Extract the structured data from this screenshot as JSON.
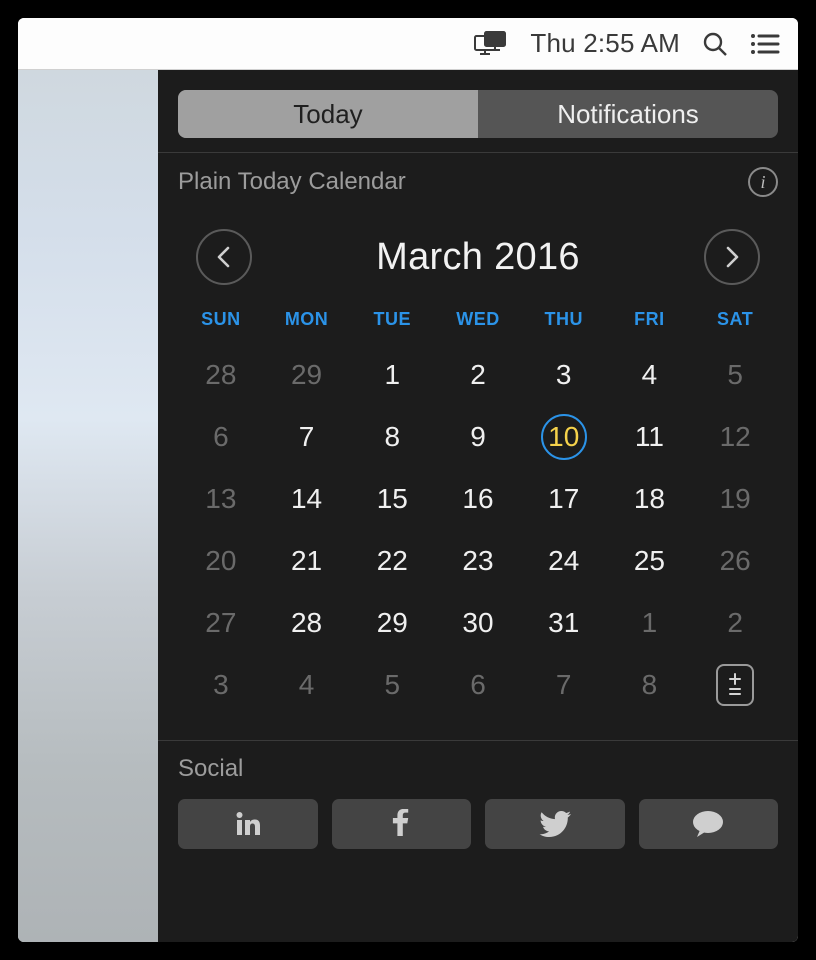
{
  "menubar": {
    "clock": "Thu 2:55 AM"
  },
  "tabs": {
    "today": "Today",
    "notifications": "Notifications",
    "active": "today"
  },
  "widget": {
    "title": "Plain Today Calendar"
  },
  "calendar": {
    "month_label": "March 2016",
    "dow": [
      "SUN",
      "MON",
      "TUE",
      "WED",
      "THU",
      "FRI",
      "SAT"
    ],
    "today": 10,
    "weeks": [
      [
        {
          "n": 28,
          "out": true
        },
        {
          "n": 29,
          "out": true
        },
        {
          "n": 1
        },
        {
          "n": 2
        },
        {
          "n": 3
        },
        {
          "n": 4
        },
        {
          "n": 5,
          "out": true
        }
      ],
      [
        {
          "n": 6,
          "out": true
        },
        {
          "n": 7
        },
        {
          "n": 8
        },
        {
          "n": 9
        },
        {
          "n": 10,
          "today": true
        },
        {
          "n": 11
        },
        {
          "n": 12,
          "out": true
        }
      ],
      [
        {
          "n": 13,
          "out": true
        },
        {
          "n": 14
        },
        {
          "n": 15
        },
        {
          "n": 16
        },
        {
          "n": 17
        },
        {
          "n": 18
        },
        {
          "n": 19,
          "out": true
        }
      ],
      [
        {
          "n": 20,
          "out": true
        },
        {
          "n": 21
        },
        {
          "n": 22
        },
        {
          "n": 23
        },
        {
          "n": 24
        },
        {
          "n": 25
        },
        {
          "n": 26,
          "out": true
        }
      ],
      [
        {
          "n": 27,
          "out": true
        },
        {
          "n": 28
        },
        {
          "n": 29
        },
        {
          "n": 30
        },
        {
          "n": 31
        },
        {
          "n": 1,
          "out": true
        },
        {
          "n": 2,
          "out": true
        }
      ],
      [
        {
          "n": 3,
          "out": true
        },
        {
          "n": 4,
          "out": true
        },
        {
          "n": 5,
          "out": true
        },
        {
          "n": 6,
          "out": true
        },
        {
          "n": 7,
          "out": true
        },
        {
          "n": 8,
          "out": true
        },
        {
          "edit": true
        }
      ]
    ]
  },
  "social": {
    "title": "Social",
    "buttons": [
      "linkedin",
      "facebook",
      "twitter",
      "message"
    ]
  }
}
